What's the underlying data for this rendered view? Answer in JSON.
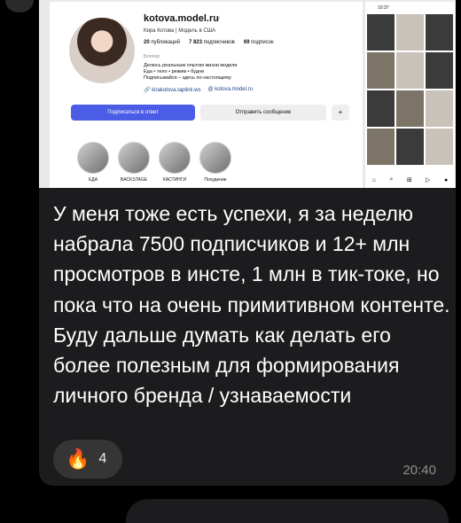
{
  "profile_screenshot": {
    "username": "kotova.model.ru",
    "full_name": "Кира Котова | Модель в США",
    "stats": [
      {
        "value": "20",
        "label": "публикаций"
      },
      {
        "value": "7 823",
        "label": "подписчиков"
      },
      {
        "value": "69",
        "label": "подписок"
      }
    ],
    "category": "Блогер",
    "bio_lines": [
      "Делюсь реальным опытом жизни модели",
      "Еда • тело • режим • будни",
      "Подписывайся – здесь по-настоящему"
    ],
    "link1": "kirakotova.taplink.ws",
    "link2": "kotova.model.ru",
    "follow_button": "Подписаться в ответ",
    "message_button": "Отправить сообщение",
    "highlights": [
      "ЕДА",
      "BACKSTAGE",
      "КАСТИНГИ",
      "Похудение"
    ]
  },
  "phone_screenshot": {
    "time": "10:37"
  },
  "message": {
    "text": "У меня тоже есть успехи, я за неделю набрала 7500 подписчиков и 12+ млн просмотров в инсте, 1 млн в тик-токе, но пока что на очень примитивном контенте. Буду дальше думать как делать его более полезным для формирования личного бренда / узнаваемости",
    "reaction_emoji": "🔥",
    "reaction_count": "4",
    "time": "20:40"
  }
}
